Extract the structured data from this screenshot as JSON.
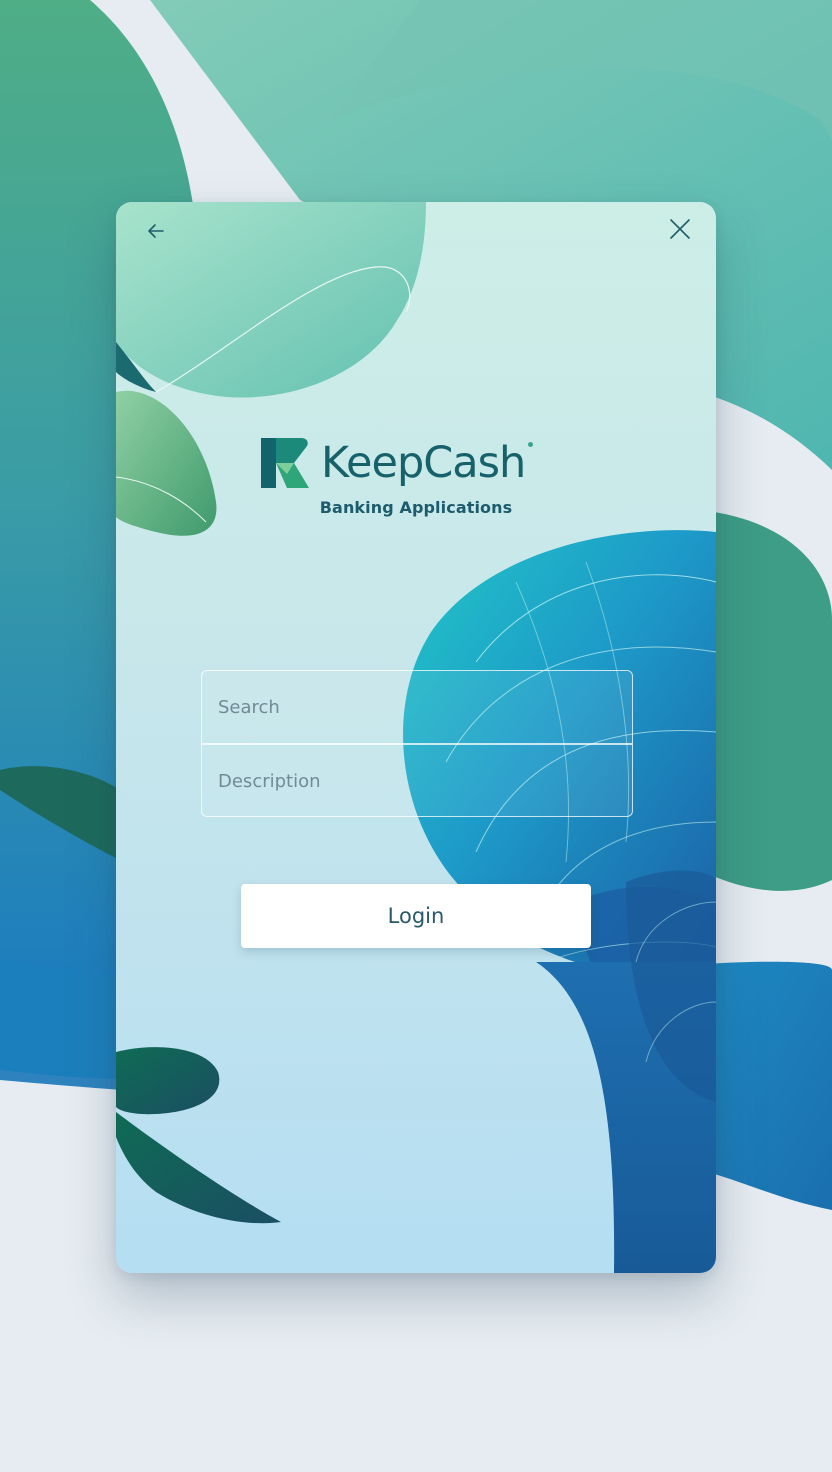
{
  "app": {
    "name": "KeepCash",
    "tagline": "Banking Applications"
  },
  "nav": {
    "back_icon": "arrow-left-icon",
    "close_icon": "close-icon"
  },
  "form": {
    "field1_placeholder": "Search",
    "field2_placeholder": "Description"
  },
  "actions": {
    "login_label": "Login"
  },
  "colors": {
    "brand": "#17616b",
    "accent_green": "#2aa58c",
    "accent_blue": "#1f6fb0",
    "background": "#e6ecf2"
  }
}
